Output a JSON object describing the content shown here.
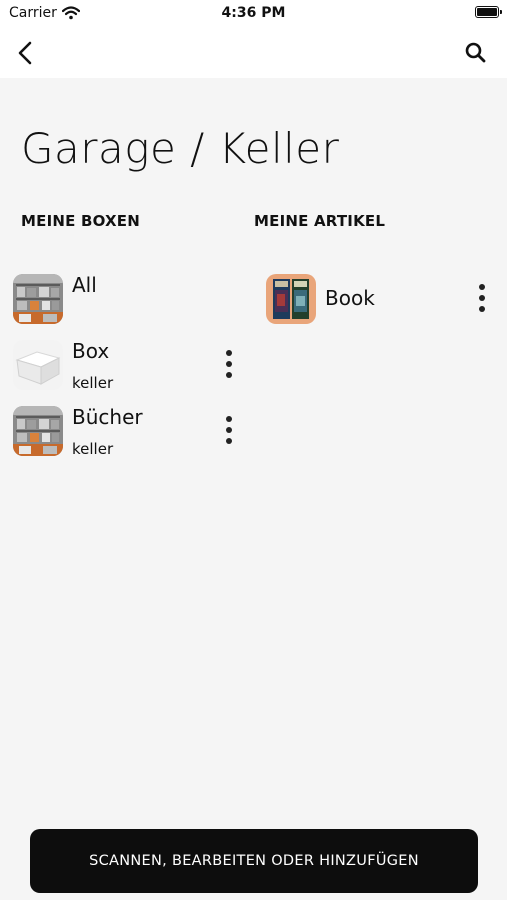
{
  "status_bar": {
    "carrier": "Carrier",
    "time": "4:36 PM"
  },
  "nav": {
    "back_icon": "chevron-left-icon",
    "search_icon": "search-icon"
  },
  "page": {
    "title": "Garage / Keller"
  },
  "boxes": {
    "heading": "MEINE BOXEN",
    "items": [
      {
        "title": "All",
        "subtitle": "",
        "thumbnail": "shelf-photo"
      },
      {
        "title": "Box",
        "subtitle": "keller",
        "thumbnail": "white-box-photo"
      },
      {
        "title": "Bücher",
        "subtitle": "keller",
        "thumbnail": "shelf-photo"
      }
    ]
  },
  "articles": {
    "heading": "MEINE ARTIKEL",
    "items": [
      {
        "title": "Book",
        "thumbnail": "book-cover-photo"
      }
    ]
  },
  "action_button": {
    "label": "SCANNEN, BEARBEITEN ODER HINZUFÜGEN"
  }
}
